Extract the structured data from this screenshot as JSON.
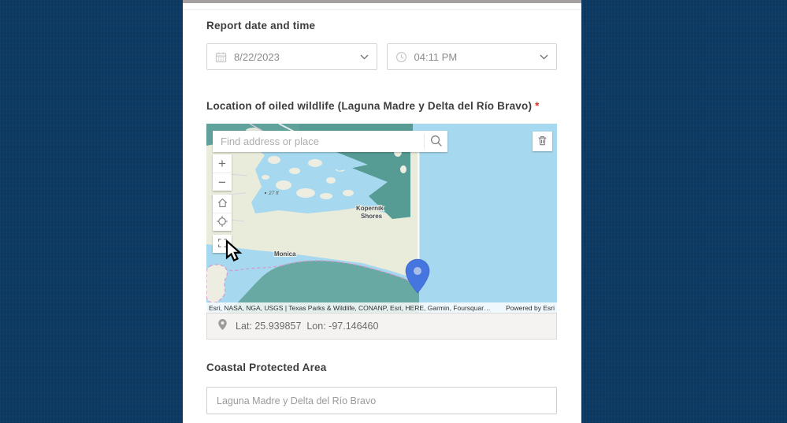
{
  "page": {
    "report_section": {
      "heading": "Report date and time"
    },
    "date_field": {
      "value": "8/22/2023"
    },
    "time_field": {
      "value": "04:11 PM"
    },
    "location_section": {
      "heading": "Location of oiled wildlife (Laguna Madre y Delta del Río Bravo)",
      "required_mark": "*"
    },
    "map": {
      "search_placeholder": "Find address or place",
      "zoom_in_label": "+",
      "zoom_out_label": "−",
      "label_elevation": "27 ft",
      "label_kopernik_line1": "Kopernik",
      "label_kopernik_line2": "Shores",
      "label_monica": "Monica",
      "attribution": "Esri, NASA, NGA, USGS | Texas Parks & Wildlife, CONANP, Esri, HERE, Garmin, Foursquar…",
      "powered_by": "Powered by Esri"
    },
    "coordinates": {
      "text": "Lat: 25.939857  Lon: -97.146460"
    },
    "coastal_section": {
      "heading": "Coastal Protected Area",
      "value": "Laguna Madre y Delta del Río Bravo"
    }
  },
  "colors": {
    "navy_background": "#0d3a63",
    "map_water": "#a6d8ef",
    "map_land_teal_dark": "#579b95",
    "map_land_teal": "#68aaa3",
    "map_land_pale": "#e9ecdb",
    "boundary_pink": "#d49fd0",
    "pin_blue": "#4576e0",
    "required_red": "#d83020"
  }
}
